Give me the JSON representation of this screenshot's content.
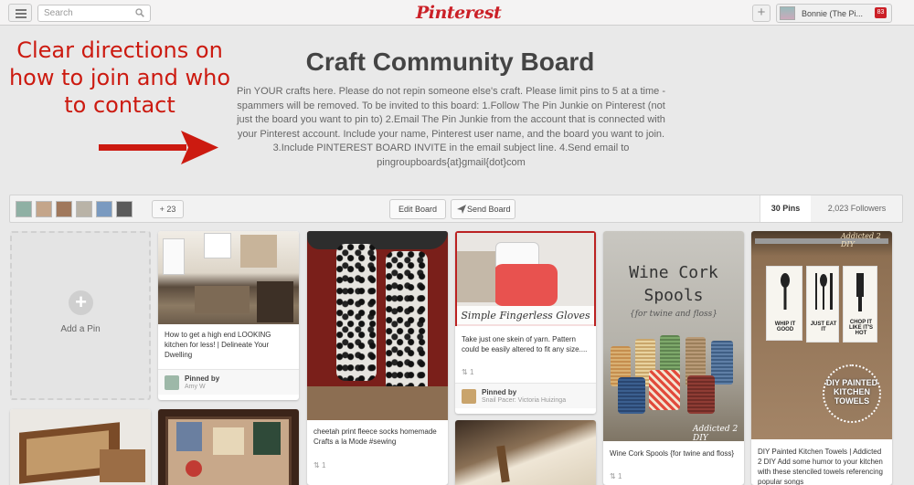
{
  "topbar": {
    "search_placeholder": "Search",
    "logo": "Pinterest",
    "user_name": "Bonnie (The Pi...",
    "notification_count": "83"
  },
  "annotation": {
    "lines": [
      "Clear directions on",
      "how to join and who",
      "to contact"
    ],
    "color": "#cc1a10"
  },
  "board": {
    "title": "Craft Community Board",
    "description": "Pin YOUR crafts here. Please do not repin someone else's craft. Please limit pins to 5 at a time - spammers will be removed. To be invited to this board: 1.Follow The Pin Junkie on Pinterest (not just the board you want to pin to) 2.Email The Pin Junkie from the account that is connected with your Pinterest account. Include your name, Pinterest user name, and the board you want to join. 3.Include PINTEREST BOARD INVITE in the email subject line. 4.Send email to pingroupboards{at}gmail{dot}com"
  },
  "actions": {
    "more_collaborators": "+ 23",
    "edit_board": "Edit Board",
    "send_board": "Send Board",
    "pins_count": "30 Pins",
    "followers_count": "2,023 Followers"
  },
  "add_pin": {
    "label": "Add a Pin"
  },
  "pins": [
    {
      "description": "How to get a high end LOOKING kitchen for less! | Delineate Your Dwelling",
      "pinned_by_label": "Pinned by",
      "pinner": "Amy W"
    },
    {
      "description": "cheetah print fleece socks homemade Crafts a la Mode #sewing",
      "repins": "1"
    },
    {
      "image_text": "Simple Fingerless Gloves",
      "description": "Take just one skein of yarn. Pattern could be easily altered to fit any size....",
      "repins": "1",
      "pinned_by_label": "Pinned by",
      "pinner": "Snail Pacer: Victoria Huizinga"
    },
    {
      "image_title_line1": "Wine Cork",
      "image_title_line2": "Spools",
      "image_subtitle": "{for twine and floss}",
      "image_watermark": "Addicted 2 DIY",
      "description": "Wine Cork Spools {for twine and floss}",
      "repins": "1"
    },
    {
      "image_watermark": "Addicted 2 DIY",
      "towels": [
        "WHIP IT GOOD",
        "JUST EAT IT",
        "CHOP IT LIKE IT'S HOT"
      ],
      "stamp": "DIY PAINTED KITCHEN TOWELS",
      "description": "DIY Painted Kitchen Towels | Addicted 2 DIY Add some humor to your kitchen with these stenciled towels referencing popular songs"
    }
  ],
  "colors": {
    "brand": "#cb2027",
    "background": "#e9e9e9"
  }
}
